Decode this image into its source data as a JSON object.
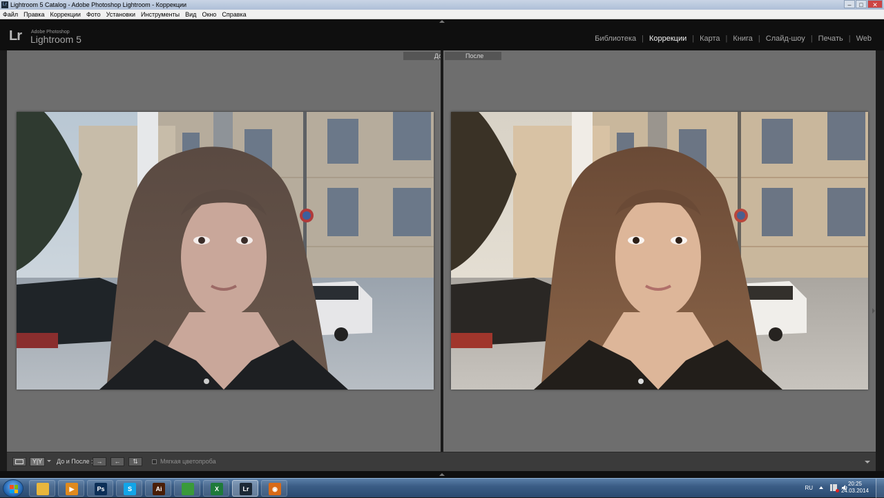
{
  "window": {
    "title": "Lightroom 5 Catalog - Adobe Photoshop Lightroom - Коррекции",
    "app_icon_text": "Lr",
    "controls": [
      "minimize-icon",
      "maximize-icon",
      "close-icon"
    ]
  },
  "menu": [
    "Файл",
    "Правка",
    "Коррекции",
    "Фото",
    "Установки",
    "Инструменты",
    "Вид",
    "Окно",
    "Справка"
  ],
  "identity": {
    "logo": "Lr",
    "vendor": "Adobe Photoshop",
    "product": "Lightroom 5"
  },
  "modules": [
    {
      "label": "Библиотека",
      "active": false
    },
    {
      "label": "Коррекции",
      "active": true
    },
    {
      "label": "Карта",
      "active": false
    },
    {
      "label": "Книга",
      "active": false
    },
    {
      "label": "Слайд-шоу",
      "active": false
    },
    {
      "label": "Печать",
      "active": false
    },
    {
      "label": "Web",
      "active": false
    }
  ],
  "compare": {
    "before_label": "До",
    "after_label": "После"
  },
  "toolbar": {
    "view_mode_label": "Y|Y",
    "before_after_label": "До и После :",
    "copy_after_to_before": "→",
    "copy_before_to_after": "←",
    "swap": "⇅",
    "soft_proof_label": "Мягкая цветопроба",
    "soft_proof_checked": false
  },
  "taskbar": {
    "apps": [
      {
        "name": "explorer-icon",
        "text": "",
        "color": "#e8b63c"
      },
      {
        "name": "media-player-icon",
        "text": "▶",
        "color": "#e08a1e"
      },
      {
        "name": "photoshop-icon",
        "text": "Ps",
        "color": "#0c2f57"
      },
      {
        "name": "skype-icon",
        "text": "S",
        "color": "#12a5e8"
      },
      {
        "name": "illustrator-icon",
        "text": "Ai",
        "color": "#4a1e06"
      },
      {
        "name": "chrome-icon",
        "text": "",
        "color": "#3a9a3a"
      },
      {
        "name": "excel-icon",
        "text": "X",
        "color": "#1e7a3a"
      },
      {
        "name": "lightroom-icon",
        "text": "Lr",
        "color": "#1c2836"
      },
      {
        "name": "eye-app-icon",
        "text": "◉",
        "color": "#d96a17"
      }
    ],
    "language": "RU",
    "time": "20:25",
    "date": "24.03.2014"
  }
}
